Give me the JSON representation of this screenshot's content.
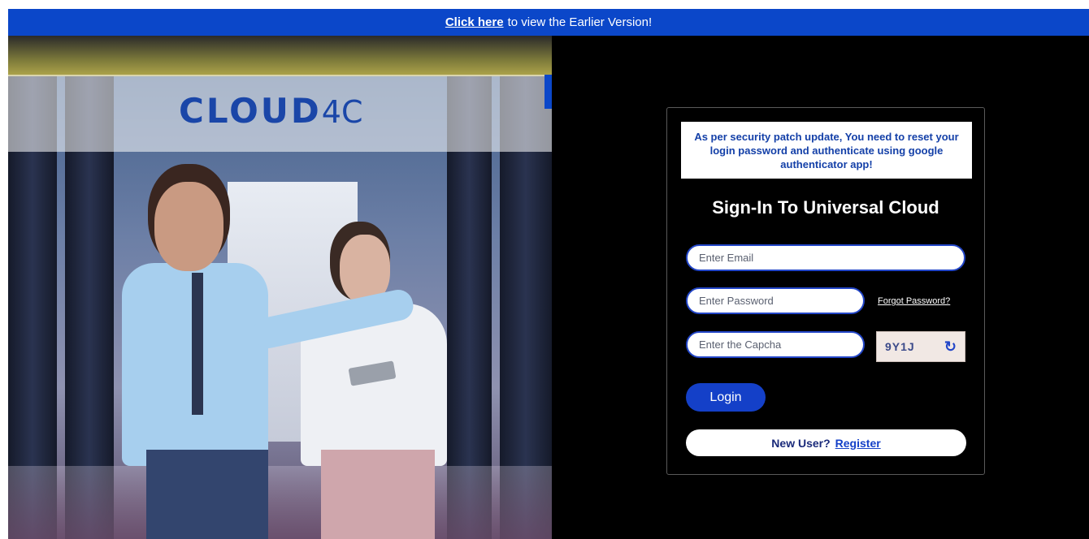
{
  "banner": {
    "link_text": "Click here",
    "rest_text": "to view the Earlier Version!"
  },
  "brand": {
    "logo_main": "CLOUD",
    "logo_suffix": "4C"
  },
  "login": {
    "notice": "As per security patch update, You need to reset your login password and authenticate using google authenticator app!",
    "title": "Sign-In To Universal Cloud",
    "email_placeholder": "Enter Email",
    "password_placeholder": "Enter Password",
    "forgot_label": "Forgot Password?",
    "captcha_placeholder": "Enter the Capcha",
    "captcha_code": "9Y1J",
    "refresh_icon": "↻",
    "login_label": "Login",
    "new_user_label": "New User?",
    "register_label": "Register"
  },
  "colors": {
    "accent": "#0b47c9",
    "panel_bg": "#000000",
    "text_light": "#ffffff"
  }
}
